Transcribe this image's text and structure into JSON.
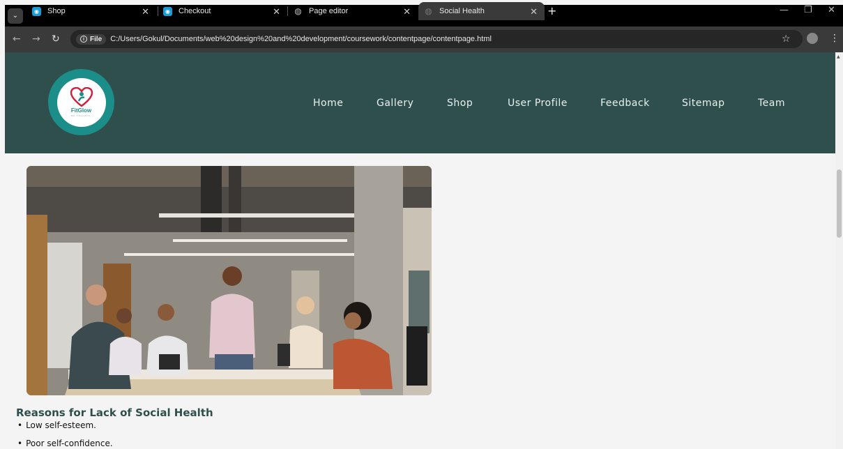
{
  "browser": {
    "tabs": [
      {
        "label": "Shop",
        "icon": "app-icon"
      },
      {
        "label": "Checkout",
        "icon": "app-icon"
      },
      {
        "label": "Page editor",
        "icon": "globe-icon"
      },
      {
        "label": "Social Health",
        "icon": "globe-icon",
        "active": true
      }
    ],
    "site_chip": "File",
    "url": "C:/Users/Gokul/Documents/web%20design%20and%20development/coursework/contentpage/contentpage.html"
  },
  "site": {
    "logo_text": "FitGlow",
    "logo_subtext": "BE HEALTHY",
    "nav": [
      "Home",
      "Gallery",
      "Shop",
      "User Profile",
      "Feedback",
      "Sitemap",
      "Team"
    ],
    "header_color": "#2f4f4d",
    "accent_color": "#1b8e8a"
  },
  "content": {
    "section_title": "Reasons for Lack of Social Health",
    "reasons": [
      "Low self-esteem.",
      "Poor self-confidence."
    ]
  }
}
